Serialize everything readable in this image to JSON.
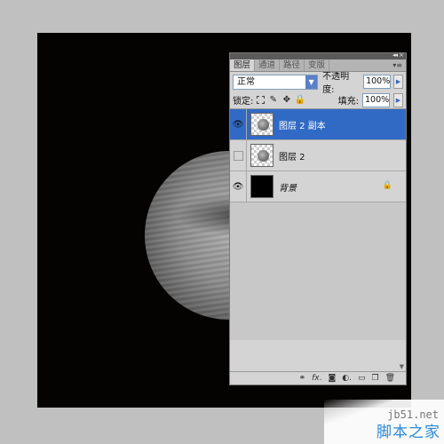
{
  "panel": {
    "tabs": [
      "图层",
      "通道",
      "路径",
      "变版"
    ],
    "blend_mode": "正常",
    "opacity_label": "不透明度:",
    "opacity_value": "100%",
    "lock_label": "锁定:",
    "fill_label": "填充:",
    "fill_value": "100%",
    "layers": [
      {
        "name": "图层 2 副本",
        "visible": true,
        "selected": true
      },
      {
        "name": "图层 2",
        "visible": false,
        "selected": false
      },
      {
        "name": "背景",
        "visible": true,
        "selected": false,
        "locked": true
      }
    ],
    "bottom_icons": [
      "link-icon",
      "fx-icon",
      "mask-icon",
      "adjustment-icon",
      "group-icon",
      "new-layer-icon",
      "trash-icon"
    ]
  },
  "watermark": {
    "site": "jb51.net",
    "name": "脚本之家"
  }
}
